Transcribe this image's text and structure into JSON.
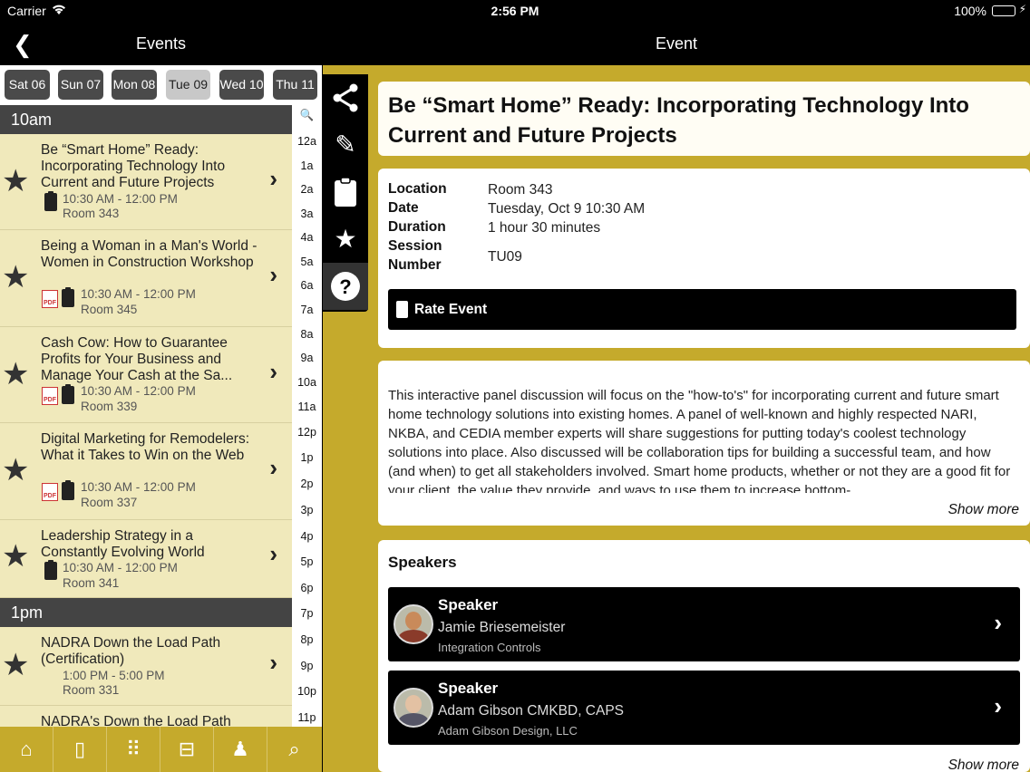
{
  "status": {
    "carrier": "Carrier",
    "time": "2:56 PM",
    "battery": "100%"
  },
  "left": {
    "title": "Events",
    "days": [
      "Sat 06",
      "Sun 07",
      "Mon 08",
      "Tue 09",
      "Wed 10",
      "Thu 11"
    ],
    "active_day": "Tue 09",
    "sections": [
      {
        "label": "10am",
        "items": [
          {
            "title": "Be “Smart Home” Ready: Incorporating Technology Into Current and Future Projects",
            "time": "10:30 AM - 12:00 PM",
            "room": "Room 343",
            "pdf": false
          },
          {
            "title": "Being a Woman in a Man's World - Women in Construction Workshop",
            "time": "10:30 AM - 12:00 PM",
            "room": "Room 345",
            "pdf": true
          },
          {
            "title": "Cash Cow: How to Guarantee Profits for Your Business and Manage Your Cash at the Sa...",
            "time": "10:30 AM - 12:00 PM",
            "room": "Room 339",
            "pdf": true
          },
          {
            "title": "Digital Marketing for Remodelers: What it Takes to Win on the Web",
            "time": "10:30 AM - 12:00 PM",
            "room": "Room 337",
            "pdf": true
          },
          {
            "title": "Leadership Strategy in a Constantly Evolving World",
            "time": "10:30 AM - 12:00 PM",
            "room": "Room 341",
            "pdf": false
          }
        ]
      },
      {
        "label": "1pm",
        "items": [
          {
            "title": "NADRA Down the Load Path (Certification)",
            "time": "1:00 PM - 5:00 PM",
            "room": "Room 331",
            "pdf": false
          },
          {
            "title": "NADRA's Down the Load Path",
            "time": "",
            "room": "",
            "pdf": false
          }
        ]
      }
    ],
    "index": [
      "12a",
      "1a",
      "2a",
      "3a",
      "4a",
      "5a",
      "6a",
      "7a",
      "8a",
      "9a",
      "10a",
      "11a",
      "12p",
      "1p",
      "2p",
      "3p",
      "4p",
      "5p",
      "6p",
      "7p",
      "8p",
      "9p",
      "10p",
      "11p"
    ]
  },
  "right": {
    "title": "Event",
    "event_title": "Be “Smart Home” Ready: Incorporating Technology Into Current and Future Projects",
    "labels": {
      "location": "Location",
      "date": "Date",
      "duration": "Duration",
      "session1": "Session",
      "session2": "Number"
    },
    "values": {
      "location": "Room 343",
      "date": "Tuesday, Oct 9 10:30 AM",
      "duration": "1 hour 30 minutes",
      "session": "TU09"
    },
    "rate_label": "Rate Event",
    "description": "This interactive panel discussion will focus on the \"how-to's\" for incorporating current and future smart home technology solutions into existing homes. A panel of well-known and highly respected NARI, NKBA, and CEDIA member experts will share suggestions for putting today's coolest technology solutions into place. Also discussed will be collaboration tips for building a successful team, and how (and when) to get all stakeholders involved. Smart home products, whether or not they are a good fit for your client, the value they provide, and ways to use them to increase bottom-",
    "show_more": "Show more",
    "speakers_heading": "Speakers",
    "speakers": [
      {
        "role": "Speaker",
        "name": "Jamie Briesemeister",
        "org": "Integration Controls"
      },
      {
        "role": "Speaker",
        "name": "Adam Gibson CMKBD, CAPS",
        "org": "Adam Gibson Design, LLC"
      }
    ]
  },
  "colors": {
    "accent": "#c5aa2c",
    "list_bg": "#f0e9bb",
    "bar": "#000000"
  },
  "icons": {
    "rail": [
      "share-icon",
      "pencil-icon",
      "clipboard-icon",
      "star-icon",
      "help-icon"
    ],
    "tabs": [
      "home-icon",
      "mobile-icon",
      "grid-icon",
      "presentation-icon",
      "person-icon",
      "search-icon"
    ]
  }
}
